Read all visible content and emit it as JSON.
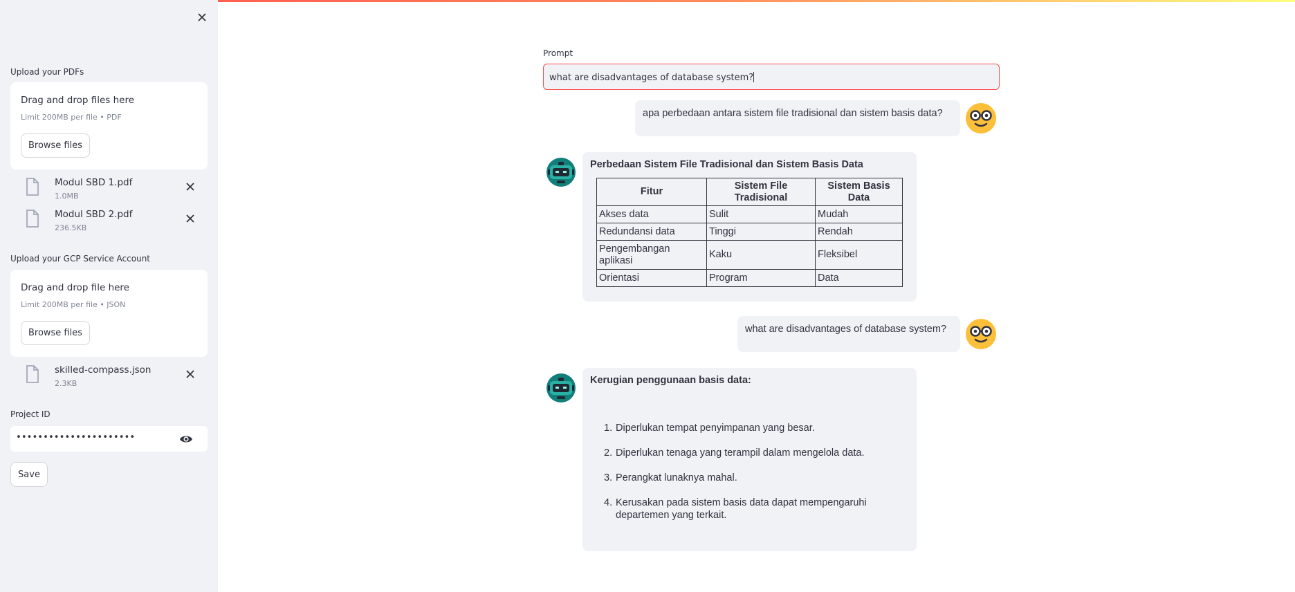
{
  "colors": {
    "accent": "#ff4b4b",
    "sidebar_bg": "#f0f2f6",
    "bubble_bg": "#f0f2f6",
    "text": "#31333f",
    "muted": "#808495"
  },
  "sidebar": {
    "close_icon": "close-icon",
    "pdf_uploader": {
      "label": "Upload your PDFs",
      "drop_title": "Drag and drop files here",
      "drop_limit": "Limit 200MB per file • PDF",
      "browse_label": "Browse files",
      "files": [
        {
          "name": "Modul SBD 1.pdf",
          "size": "1.0MB"
        },
        {
          "name": "Modul SBD 2.pdf",
          "size": "236.5KB"
        }
      ]
    },
    "gcp_uploader": {
      "label": "Upload your GCP Service Account",
      "drop_title": "Drag and drop file here",
      "drop_limit": "Limit 200MB per file • JSON",
      "browse_label": "Browse files",
      "files": [
        {
          "name": "skilled-compass.json",
          "size": "2.3KB"
        }
      ]
    },
    "project_id": {
      "label": "Project ID",
      "value": "••••••••••••••••••••••"
    },
    "save_label": "Save"
  },
  "main": {
    "prompt": {
      "label": "Prompt",
      "value": "what are disadvantages of database system?"
    },
    "messages": [
      {
        "role": "user",
        "text": "apa perbedaan antara sistem file tradisional dan sistem basis data?"
      },
      {
        "role": "assistant",
        "title": "Perbedaan Sistem File Tradisional dan Sistem Basis Data",
        "table": {
          "headers": [
            "Fitur",
            "Sistem File Tradisional",
            "Sistem Basis Data"
          ],
          "rows": [
            [
              "Akses data",
              "Sulit",
              "Mudah"
            ],
            [
              "Redundansi data",
              "Tinggi",
              "Rendah"
            ],
            [
              "Pengembangan aplikasi",
              "Kaku",
              "Fleksibel"
            ],
            [
              "Orientasi",
              "Program",
              "Data"
            ]
          ]
        }
      },
      {
        "role": "user",
        "text": "what are disadvantages of database system?"
      },
      {
        "role": "assistant",
        "title": "Kerugian penggunaan basis data:",
        "list": [
          "Diperlukan tempat penyimpanan yang besar.",
          "Diperlukan tenaga yang terampil dalam mengelola data.",
          "Perangkat lunaknya mahal.",
          "Kerusakan pada sistem basis data dapat mempengaruhi",
          "departemen yang terkait."
        ]
      }
    ]
  }
}
